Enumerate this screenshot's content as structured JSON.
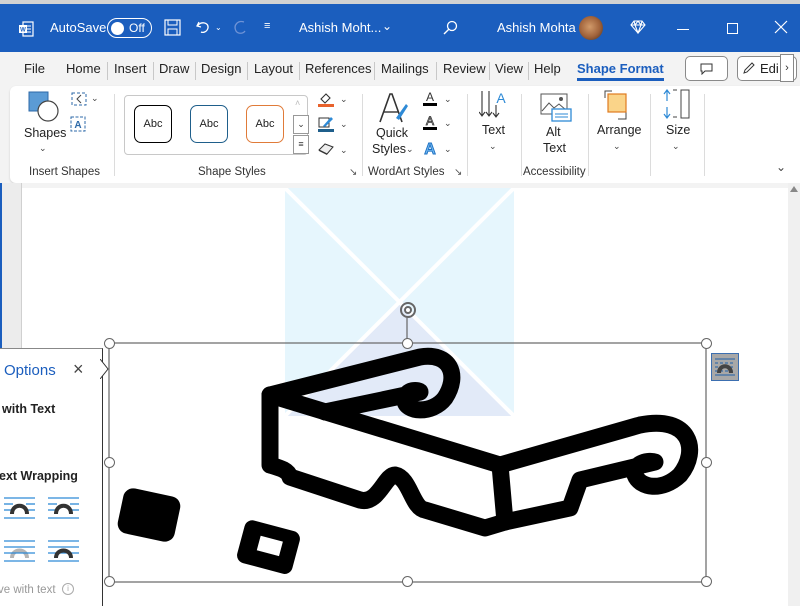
{
  "titlebar": {
    "app_icon": "word-icon",
    "autosave_label": "AutoSave",
    "autosave_state": "Off",
    "save_icon": "save-icon",
    "undo_icon": "undo-icon",
    "redo_icon": "redo-icon",
    "customize_icon": "customize-qat-icon",
    "document_title": "Ashish Moht...",
    "search_icon": "search-icon",
    "user_name": "Ashish Mohta",
    "premium_icon": "diamond-icon",
    "minimize_icon": "minimize-icon",
    "maximize_icon": "maximize-icon",
    "close_icon": "close-icon"
  },
  "tabs": [
    {
      "label": "File"
    },
    {
      "label": "Home"
    },
    {
      "label": "Insert"
    },
    {
      "label": "Draw"
    },
    {
      "label": "Design"
    },
    {
      "label": "Layout"
    },
    {
      "label": "References"
    },
    {
      "label": "Mailings"
    },
    {
      "label": "Review"
    },
    {
      "label": "View"
    },
    {
      "label": "Help"
    },
    {
      "label": "Shape Format",
      "active": true
    }
  ],
  "tab_buttons": {
    "comments_icon": "comment-icon",
    "editing_label": "Edi",
    "editing_icon": "pencil-icon"
  },
  "ribbon": {
    "groups": [
      {
        "label": "Insert Shapes"
      },
      {
        "label": "Shape Styles"
      },
      {
        "label": "WordArt Styles"
      },
      {
        "label": ""
      },
      {
        "label": "Accessibility"
      },
      {
        "label": ""
      },
      {
        "label": ""
      }
    ],
    "shapes_label": "Shapes",
    "shape_styles": [
      {
        "label": "Abc",
        "border": "#000000"
      },
      {
        "label": "Abc",
        "border": "#1f5f8b"
      },
      {
        "label": "Abc",
        "border": "#e07b39"
      }
    ],
    "fill_color": "#e8622c",
    "outline_color": "#1f5f8b",
    "quick_styles_line1": "Quick",
    "quick_styles_line2": "Styles",
    "text_label": "Text",
    "alt_text_line1": "Alt",
    "alt_text_line2": "Text",
    "arrange_label": "Arrange",
    "size_label": "Size"
  },
  "pane": {
    "title": "Options",
    "section1": "with Text",
    "section2": "ext Wrapping",
    "disabled_option": "ve with text"
  },
  "colors": {
    "accent": "#1b5ebe",
    "placeholder_fill": "#e6f5fc"
  }
}
